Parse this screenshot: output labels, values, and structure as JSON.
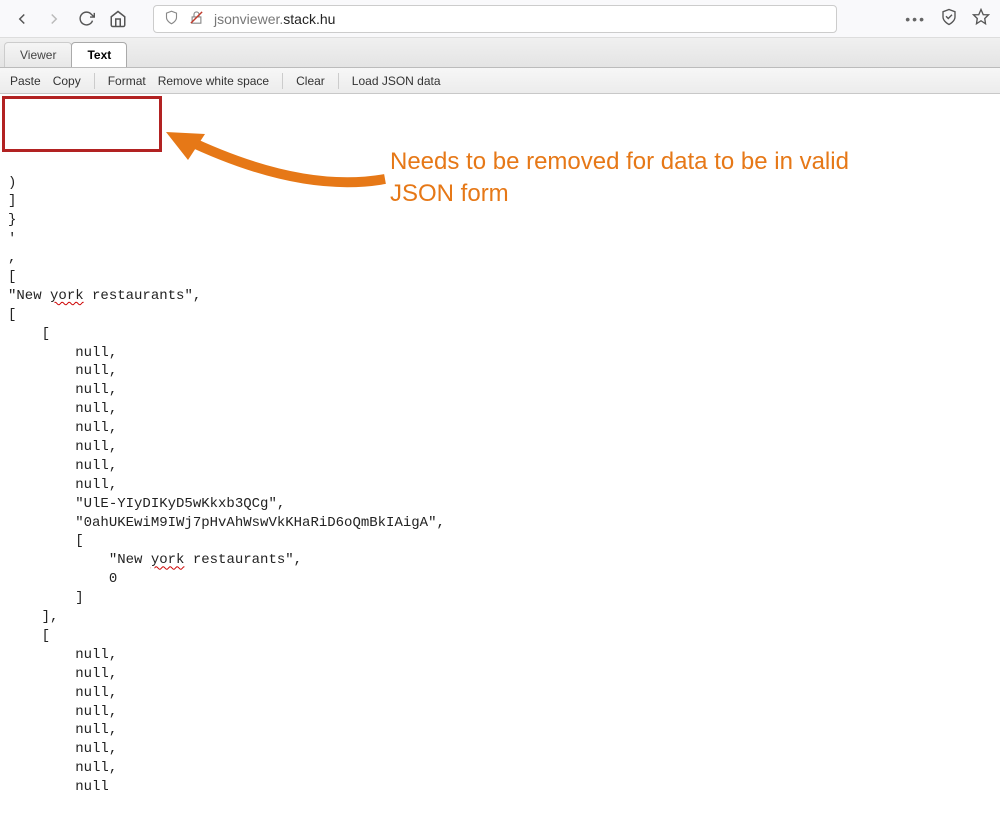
{
  "browser": {
    "url_prefix": "jsonviewer.",
    "url_domain": "stack.hu"
  },
  "tabs": {
    "viewer": "Viewer",
    "text": "Text"
  },
  "toolbar": {
    "paste": "Paste",
    "copy": "Copy",
    "format": "Format",
    "remove_ws": "Remove white space",
    "clear": "Clear",
    "load": "Load JSON data"
  },
  "annotation": {
    "text": "Needs to be removed for data to be in valid JSON form"
  },
  "code": {
    "l1": ")",
    "l2": "]",
    "l3": "}",
    "l4": "'",
    "l5": ",",
    "l6": "[",
    "l7a": "\"New ",
    "l7b": "york",
    "l7c": " restaurants\",",
    "l8": "[",
    "l9": "    [",
    "l10": "        null,",
    "l11": "        null,",
    "l12": "        null,",
    "l13": "        null,",
    "l14": "        null,",
    "l15": "        null,",
    "l16": "        null,",
    "l17": "        null,",
    "l18": "        \"UlE-YIyDIKyD5wKkxb3QCg\",",
    "l19": "        \"0ahUKEwiM9IWj7pHvAhWswVkKHaRiD6oQmBkIAigA\",",
    "l20": "        [",
    "l21a": "            \"New ",
    "l21b": "york",
    "l21c": " restaurants\",",
    "l22": "            0",
    "l23": "        ]",
    "l24": "    ],",
    "l25": "    [",
    "l26": "        null,",
    "l27": "        null,",
    "l28": "        null,",
    "l29": "        null,",
    "l30": "        null,",
    "l31": "        null,",
    "l32": "        null,",
    "l33": "        null"
  }
}
